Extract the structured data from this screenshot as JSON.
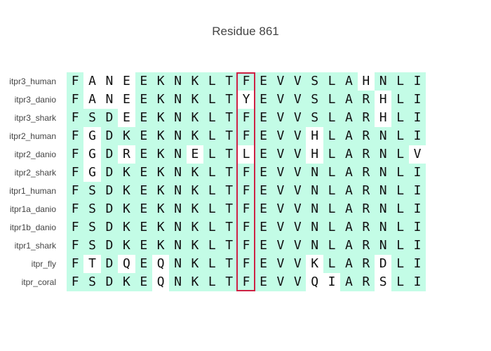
{
  "title": "Residue 861",
  "highlight_column": 10,
  "colors": {
    "conserved_bg": "#c3fce6",
    "highlight_border": "#cc2244"
  },
  "sequences": [
    {
      "name": "itpr3_human",
      "residues": [
        "F",
        "A",
        "N",
        "E",
        "E",
        "K",
        "N",
        "K",
        "L",
        "T",
        "F",
        "E",
        "V",
        "V",
        "S",
        "L",
        "A",
        "H",
        "N",
        "L",
        "I"
      ],
      "conserved": [
        1,
        0,
        0,
        0,
        1,
        1,
        1,
        1,
        1,
        1,
        1,
        1,
        1,
        1,
        1,
        1,
        1,
        0,
        1,
        1,
        1
      ]
    },
    {
      "name": "itpr3_danio",
      "residues": [
        "F",
        "A",
        "N",
        "E",
        "E",
        "K",
        "N",
        "K",
        "L",
        "T",
        "Y",
        "E",
        "V",
        "V",
        "S",
        "L",
        "A",
        "R",
        "H",
        "L",
        "I"
      ],
      "conserved": [
        1,
        0,
        0,
        0,
        1,
        1,
        1,
        1,
        1,
        1,
        0,
        1,
        1,
        1,
        1,
        1,
        1,
        1,
        0,
        1,
        1
      ]
    },
    {
      "name": "itpr3_shark",
      "residues": [
        "F",
        "S",
        "D",
        "E",
        "E",
        "K",
        "N",
        "K",
        "L",
        "T",
        "F",
        "E",
        "V",
        "V",
        "S",
        "L",
        "A",
        "R",
        "H",
        "L",
        "I"
      ],
      "conserved": [
        1,
        1,
        1,
        0,
        1,
        1,
        1,
        1,
        1,
        1,
        1,
        1,
        1,
        1,
        1,
        1,
        1,
        1,
        0,
        1,
        1
      ]
    },
    {
      "name": "itpr2_human",
      "residues": [
        "F",
        "G",
        "D",
        "K",
        "E",
        "K",
        "N",
        "K",
        "L",
        "T",
        "F",
        "E",
        "V",
        "V",
        "H",
        "L",
        "A",
        "R",
        "N",
        "L",
        "I"
      ],
      "conserved": [
        1,
        0,
        1,
        1,
        1,
        1,
        1,
        1,
        1,
        1,
        1,
        1,
        1,
        1,
        0,
        1,
        1,
        1,
        1,
        1,
        1
      ]
    },
    {
      "name": "itpr2_danio",
      "residues": [
        "F",
        "G",
        "D",
        "R",
        "E",
        "K",
        "N",
        "E",
        "L",
        "T",
        "L",
        "E",
        "V",
        "V",
        "H",
        "L",
        "A",
        "R",
        "N",
        "L",
        "V"
      ],
      "conserved": [
        1,
        0,
        1,
        0,
        1,
        1,
        1,
        0,
        1,
        1,
        0,
        1,
        1,
        1,
        0,
        1,
        1,
        1,
        1,
        1,
        0
      ]
    },
    {
      "name": "itpr2_shark",
      "residues": [
        "F",
        "G",
        "D",
        "K",
        "E",
        "K",
        "N",
        "K",
        "L",
        "T",
        "F",
        "E",
        "V",
        "V",
        "N",
        "L",
        "A",
        "R",
        "N",
        "L",
        "I"
      ],
      "conserved": [
        1,
        0,
        1,
        1,
        1,
        1,
        1,
        1,
        1,
        1,
        1,
        1,
        1,
        1,
        1,
        1,
        1,
        1,
        1,
        1,
        1
      ]
    },
    {
      "name": "itpr1_human",
      "residues": [
        "F",
        "S",
        "D",
        "K",
        "E",
        "K",
        "N",
        "K",
        "L",
        "T",
        "F",
        "E",
        "V",
        "V",
        "N",
        "L",
        "A",
        "R",
        "N",
        "L",
        "I"
      ],
      "conserved": [
        1,
        1,
        1,
        1,
        1,
        1,
        1,
        1,
        1,
        1,
        1,
        1,
        1,
        1,
        1,
        1,
        1,
        1,
        1,
        1,
        1
      ]
    },
    {
      "name": "itpr1a_danio",
      "residues": [
        "F",
        "S",
        "D",
        "K",
        "E",
        "K",
        "N",
        "K",
        "L",
        "T",
        "F",
        "E",
        "V",
        "V",
        "N",
        "L",
        "A",
        "R",
        "N",
        "L",
        "I"
      ],
      "conserved": [
        1,
        1,
        1,
        1,
        1,
        1,
        1,
        1,
        1,
        1,
        1,
        1,
        1,
        1,
        1,
        1,
        1,
        1,
        1,
        1,
        1
      ]
    },
    {
      "name": "itpr1b_danio",
      "residues": [
        "F",
        "S",
        "D",
        "K",
        "E",
        "K",
        "N",
        "K",
        "L",
        "T",
        "F",
        "E",
        "V",
        "V",
        "N",
        "L",
        "A",
        "R",
        "N",
        "L",
        "I"
      ],
      "conserved": [
        1,
        1,
        1,
        1,
        1,
        1,
        1,
        1,
        1,
        1,
        1,
        1,
        1,
        1,
        1,
        1,
        1,
        1,
        1,
        1,
        1
      ]
    },
    {
      "name": "itpr1_shark",
      "residues": [
        "F",
        "S",
        "D",
        "K",
        "E",
        "K",
        "N",
        "K",
        "L",
        "T",
        "F",
        "E",
        "V",
        "V",
        "N",
        "L",
        "A",
        "R",
        "N",
        "L",
        "I"
      ],
      "conserved": [
        1,
        1,
        1,
        1,
        1,
        1,
        1,
        1,
        1,
        1,
        1,
        1,
        1,
        1,
        1,
        1,
        1,
        1,
        1,
        1,
        1
      ]
    },
    {
      "name": "itpr_fly",
      "residues": [
        "F",
        "T",
        "D",
        "Q",
        "E",
        "Q",
        "N",
        "K",
        "L",
        "T",
        "F",
        "E",
        "V",
        "V",
        "K",
        "L",
        "A",
        "R",
        "D",
        "L",
        "I"
      ],
      "conserved": [
        1,
        0,
        1,
        0,
        1,
        0,
        1,
        1,
        1,
        1,
        1,
        1,
        1,
        1,
        0,
        1,
        1,
        1,
        0,
        1,
        1
      ]
    },
    {
      "name": "itpr_coral",
      "residues": [
        "F",
        "S",
        "D",
        "K",
        "E",
        "Q",
        "N",
        "K",
        "L",
        "T",
        "F",
        "E",
        "V",
        "V",
        "Q",
        "I",
        "A",
        "R",
        "S",
        "L",
        "I"
      ],
      "conserved": [
        1,
        1,
        1,
        1,
        1,
        0,
        1,
        1,
        1,
        1,
        1,
        1,
        1,
        1,
        0,
        0,
        1,
        1,
        0,
        1,
        1
      ]
    }
  ]
}
